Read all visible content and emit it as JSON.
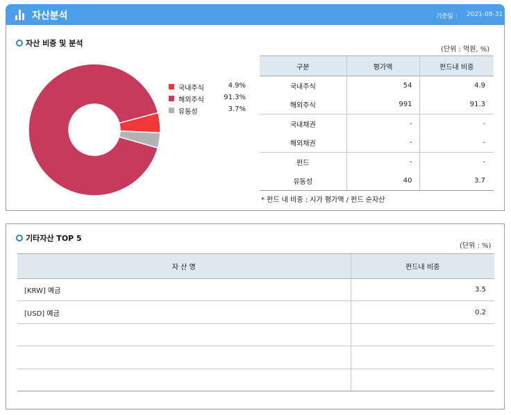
{
  "header": {
    "title": "자산분석",
    "date_label": "기준일 :",
    "date": "2021-08-31"
  },
  "section1": {
    "title": "자산 비중 및 분석",
    "unit": "(단위 : 억원, %)",
    "legend": [
      {
        "name": "국내주식",
        "value": "4.9%",
        "color": "#f03838"
      },
      {
        "name": "해외주식",
        "value": "91.3%",
        "color": "#c83a5c"
      },
      {
        "name": "유동성",
        "value": "3.7%",
        "color": "#b3b3b3"
      }
    ],
    "table": {
      "headers": [
        "구분",
        "평가액",
        "펀드내 비중"
      ],
      "rows": [
        {
          "name": "국내주식",
          "amount": "54",
          "weight": "4.9"
        },
        {
          "name": "해외주식",
          "amount": "991",
          "weight": "91.3"
        },
        {
          "name": "국내채권",
          "amount": "-",
          "weight": "-"
        },
        {
          "name": "해외채권",
          "amount": "-",
          "weight": "-"
        },
        {
          "name": "펀드",
          "amount": "-",
          "weight": "-"
        },
        {
          "name": "유동성",
          "amount": "40",
          "weight": "3.7"
        }
      ]
    },
    "note": "* 펀드 내 비중 : 시가 평가액 / 펀드 순자산"
  },
  "chart_data": {
    "type": "pie",
    "categories": [
      "해외주식",
      "국내주식",
      "유동성"
    ],
    "values": [
      91.3,
      4.9,
      3.7
    ],
    "colors": [
      "#c83a5c",
      "#f03838",
      "#b3b3b3"
    ],
    "donut": true,
    "legend": "right"
  },
  "section2": {
    "title": "기타자산 TOP 5",
    "unit": "(단위 : %)",
    "headers": [
      "자 산 명",
      "펀드내 비중"
    ],
    "rows": [
      {
        "name": "[KRW] 예금",
        "weight": "3.5"
      },
      {
        "name": "[USD] 예금",
        "weight": "0.2"
      },
      {
        "name": "",
        "weight": ""
      },
      {
        "name": "",
        "weight": ""
      },
      {
        "name": "",
        "weight": ""
      }
    ]
  }
}
